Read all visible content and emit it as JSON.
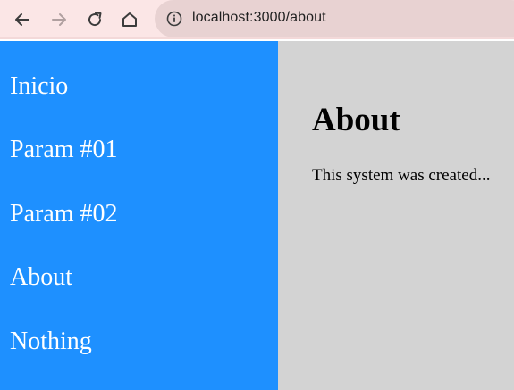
{
  "browser": {
    "url": "localhost:3000/about",
    "icons": [
      "back-arrow-icon",
      "forward-arrow-icon",
      "reload-icon",
      "home-icon",
      "info-icon"
    ]
  },
  "sidebar": {
    "items": [
      {
        "label": "Inicio"
      },
      {
        "label": "Param #01"
      },
      {
        "label": "Param #02"
      },
      {
        "label": "About"
      },
      {
        "label": "Nothing"
      }
    ],
    "background": "#1e90ff"
  },
  "main": {
    "title": "About",
    "text": "This system was created...",
    "background": "#d3d3d3"
  }
}
